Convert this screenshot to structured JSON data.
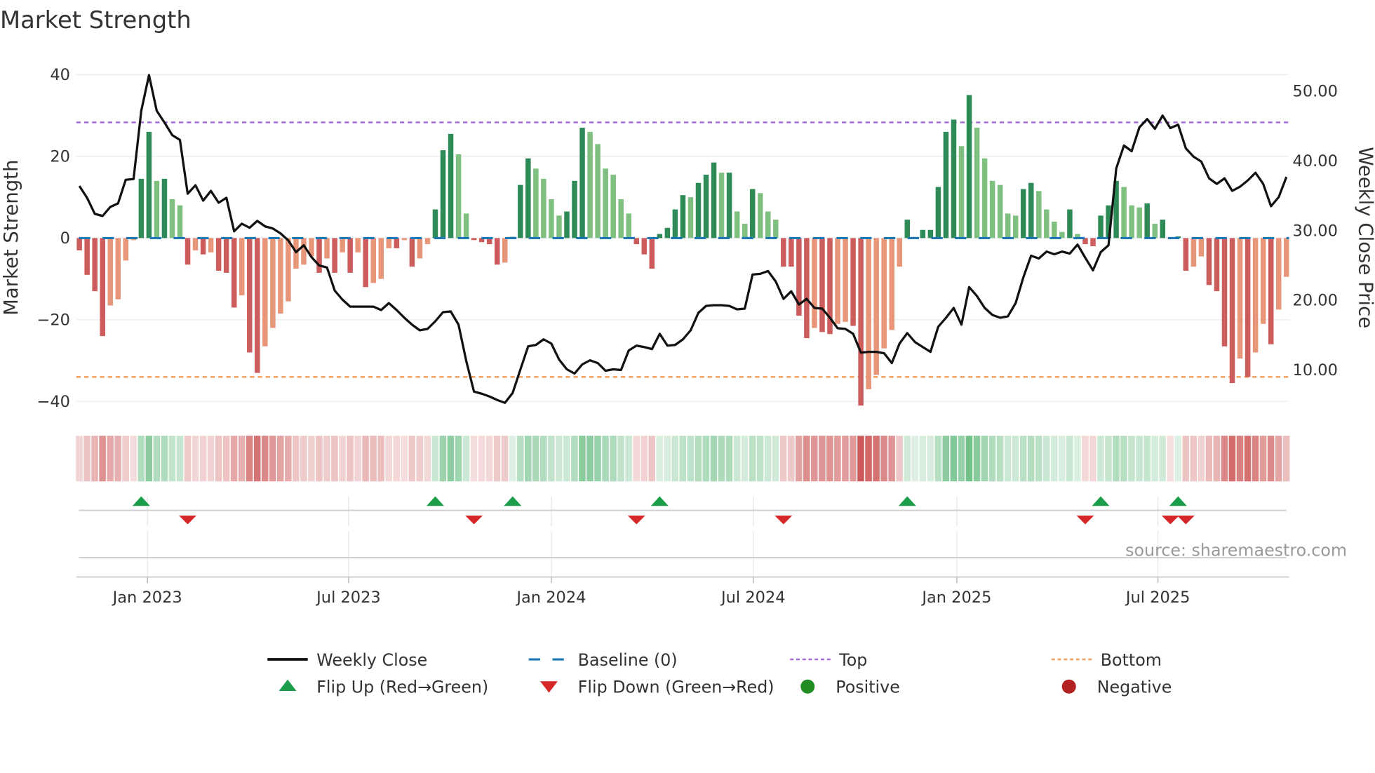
{
  "chart_data": {
    "type": "bar",
    "title": "Market Strength",
    "ylabel": "Market Strength",
    "ylabel_right": "Weekly Close Price",
    "ylim": [
      -40,
      40
    ],
    "yticks": [
      40,
      20,
      0,
      -20,
      -40
    ],
    "ytick_labels": [
      "40",
      "20",
      "0",
      "−20",
      "−40"
    ],
    "ylim_right": [
      10,
      50
    ],
    "yticks_right": [
      "50.00",
      "40.00",
      "30.00",
      "20.00",
      "10.00"
    ],
    "yticks_right_values": [
      50,
      40,
      30,
      20,
      10
    ],
    "x_unit": "week index",
    "xticks": [
      {
        "label": "Jan 2023",
        "week": 8.8
      },
      {
        "label": "Jul 2023",
        "week": 34.8
      },
      {
        "label": "Jan 2024",
        "week": 61
      },
      {
        "label": "Jul 2024",
        "week": 87.1
      },
      {
        "label": "Jan 2025",
        "week": 113.4
      },
      {
        "label": "Jul 2025",
        "week": 139.4
      }
    ],
    "grid": true,
    "top_level": 28.3,
    "bottom_level": -34,
    "baseline": 0,
    "strength": [
      -3,
      -9,
      -13,
      -24,
      -16.5,
      -15,
      -5.5,
      -0.5,
      14.5,
      26,
      14,
      14.5,
      9.5,
      8,
      -6.5,
      -3,
      -4,
      -3.5,
      -8,
      -8.5,
      -17,
      -14,
      -28,
      -33,
      -26.5,
      -22,
      -18.5,
      -15.5,
      -7.5,
      -6.5,
      -4.5,
      -8.5,
      -5,
      -8.5,
      -3.5,
      -8.5,
      -3.5,
      -12,
      -11,
      -10,
      -2.5,
      -2.5,
      -0.5,
      -7,
      -5,
      -1.5,
      7,
      21.5,
      25.5,
      20.5,
      6,
      -0.5,
      -1,
      -1.5,
      -6.5,
      -6,
      0.3,
      13,
      19.5,
      17,
      14.5,
      9.5,
      5.5,
      6.5,
      14,
      27,
      26,
      23,
      17,
      15.5,
      9.5,
      6,
      -1.5,
      -4,
      -7.5,
      1,
      2.5,
      7,
      10.5,
      10,
      13.5,
      15.5,
      18.5,
      16,
      16,
      6.5,
      3.5,
      12,
      11,
      6.5,
      4.5,
      -7,
      -7,
      -19,
      -24.5,
      -22,
      -23,
      -23.5,
      -21,
      -20.5,
      -21.5,
      -41,
      -37,
      -33.5,
      -27,
      -22.5,
      -7,
      4.5,
      0.3,
      2,
      2,
      12.5,
      26,
      29,
      22.5,
      35,
      27,
      19.5,
      14,
      13,
      6,
      5.5,
      12,
      13.5,
      11.5,
      7,
      4,
      1.5,
      7,
      1,
      -1.5,
      -2,
      5.5,
      8,
      14,
      12.5,
      8,
      7.5,
      8.5,
      3.5,
      4.5,
      -0.2,
      0.4,
      -8,
      -7,
      -4.5,
      -11.5,
      -13,
      -26.5,
      -35.5,
      -29.5,
      -34,
      -28,
      -21,
      -26,
      -17.5,
      -9.5
    ],
    "weekly_close": [
      36.4,
      34.7,
      32.4,
      32.1,
      33.4,
      33.9,
      37.3,
      37.4,
      47.2,
      52.3,
      47.2,
      45.5,
      43.7,
      43.0,
      35.3,
      36.5,
      34.3,
      35.7,
      34.0,
      34.7,
      29.9,
      31.0,
      30.4,
      31.4,
      30.6,
      30.3,
      29.6,
      28.6,
      26.9,
      27.9,
      26.2,
      25.0,
      24.7,
      21.4,
      20.1,
      19.1,
      19.1,
      19.1,
      19.1,
      18.6,
      19.6,
      18.6,
      17.5,
      16.5,
      15.7,
      15.9,
      17.0,
      18.3,
      18.4,
      16.5,
      11.3,
      6.9,
      6.6,
      6.2,
      5.7,
      5.3,
      6.7,
      10.1,
      13.4,
      13.6,
      14.4,
      13.8,
      11.5,
      10.1,
      9.5,
      10.8,
      11.4,
      11.0,
      9.9,
      10.1,
      10.0,
      12.8,
      13.5,
      13.3,
      13.0,
      15.2,
      13.5,
      13.6,
      14.4,
      15.7,
      18.2,
      19.2,
      19.3,
      19.3,
      19.2,
      18.7,
      18.8,
      23.7,
      23.8,
      24.2,
      22.7,
      20.2,
      21.3,
      19.4,
      20.2,
      18.9,
      18.8,
      17.5,
      16.0,
      15.9,
      15.2,
      12.5,
      12.6,
      12.6,
      12.4,
      11.0,
      13.8,
      15.3,
      14.0,
      13.3,
      12.6,
      16.2,
      17.5,
      18.9,
      16.5,
      21.9,
      20.6,
      18.9,
      17.9,
      17.5,
      17.7,
      19.6,
      23.3,
      26.4,
      26.0,
      27.0,
      26.6,
      27.0,
      26.7,
      28.0,
      26.1,
      24.3,
      26.9,
      27.9,
      38.9,
      42.2,
      41.4,
      44.8,
      46.0,
      44.6,
      46.5,
      44.7,
      45.2,
      41.8,
      40.6,
      39.9,
      37.5,
      36.7,
      37.5,
      35.7,
      36.3,
      37.2,
      38.3,
      36.7,
      33.5,
      34.8,
      37.7
    ],
    "legend_position": "bottom",
    "legend": [
      {
        "label": "Weekly Close",
        "kind": "line"
      },
      {
        "label": "Baseline (0)",
        "kind": "baseline"
      },
      {
        "label": "Top",
        "kind": "top"
      },
      {
        "label": "Bottom",
        "kind": "bottom"
      },
      {
        "label": "Flip Up (Red→Green)",
        "kind": "flip-up"
      },
      {
        "label": "Flip Down (Green→Red)",
        "kind": "flip-down"
      },
      {
        "label": "Positive",
        "kind": "positive"
      },
      {
        "label": "Negative",
        "kind": "negative"
      }
    ],
    "annotation": "source: sharemaestro.com"
  },
  "colors": {
    "green_strong": "#2e8b57",
    "green_weak": "#7fbf7f",
    "red_strong": "#cd5c5c",
    "red_weak": "#e8967a",
    "line": "#111111",
    "baseline": "#1f77b4",
    "top": "#a36ad8",
    "bottom": "#f0a060",
    "flip_up": "#1a9e4a",
    "flip_down": "#d62728",
    "positive": "#228b22",
    "negative": "#b22222",
    "grid": "#eceff4"
  }
}
